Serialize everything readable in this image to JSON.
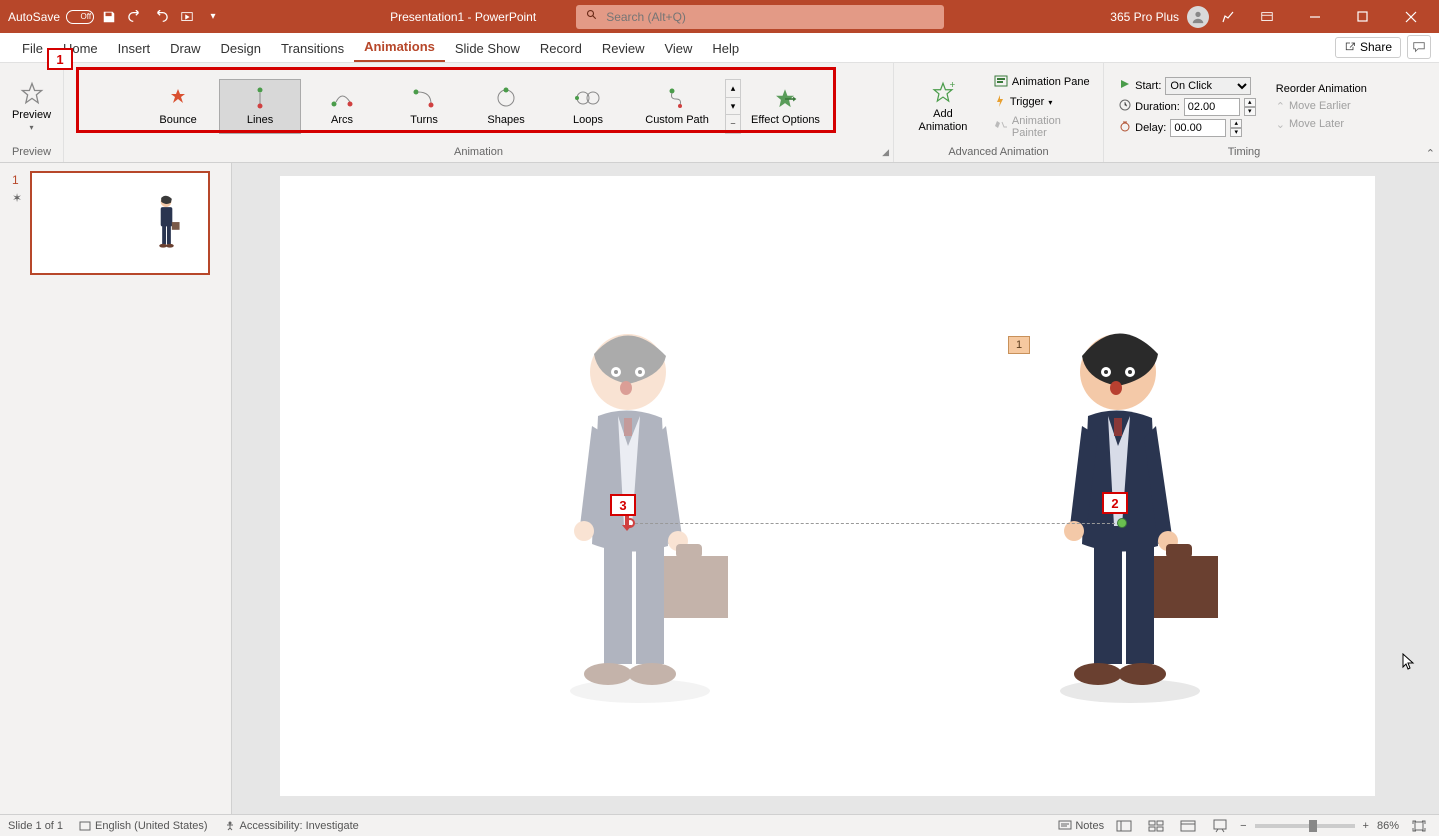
{
  "titlebar": {
    "autosave_label": "AutoSave",
    "autosave_state": "Off",
    "doc_title": "Presentation1 - PowerPoint",
    "search_placeholder": "Search (Alt+Q)",
    "account_label": "365 Pro Plus"
  },
  "tabs": {
    "file": "File",
    "home": "Home",
    "insert": "Insert",
    "draw": "Draw",
    "design": "Design",
    "transitions": "Transitions",
    "animations": "Animations",
    "slideshow": "Slide Show",
    "record": "Record",
    "review": "Review",
    "view": "View",
    "help": "Help",
    "share": "Share"
  },
  "ribbon": {
    "preview_btn": "Preview",
    "preview_group": "Preview",
    "gallery": {
      "bounce": "Bounce",
      "lines": "Lines",
      "arcs": "Arcs",
      "turns": "Turns",
      "shapes": "Shapes",
      "loops": "Loops",
      "custom_path": "Custom Path"
    },
    "animation_group": "Animation",
    "effect_options": "Effect Options",
    "add_animation": "Add Animation",
    "animation_pane": "Animation Pane",
    "trigger": "Trigger",
    "animation_painter": "Animation Painter",
    "advanced_group": "Advanced Animation",
    "timing": {
      "start_label": "Start:",
      "start_value": "On Click",
      "duration_label": "Duration:",
      "duration_value": "02.00",
      "delay_label": "Delay:",
      "delay_value": "00.00",
      "reorder": "Reorder Animation",
      "move_earlier": "Move Earlier",
      "move_later": "Move Later",
      "group": "Timing"
    }
  },
  "callouts": {
    "c1": "1",
    "c2": "2",
    "c3": "3"
  },
  "thumb": {
    "num": "1"
  },
  "slide": {
    "anim_tag": "1"
  },
  "statusbar": {
    "slide_info": "Slide 1 of 1",
    "language": "English (United States)",
    "accessibility": "Accessibility: Investigate",
    "notes": "Notes",
    "zoom": "86%"
  }
}
